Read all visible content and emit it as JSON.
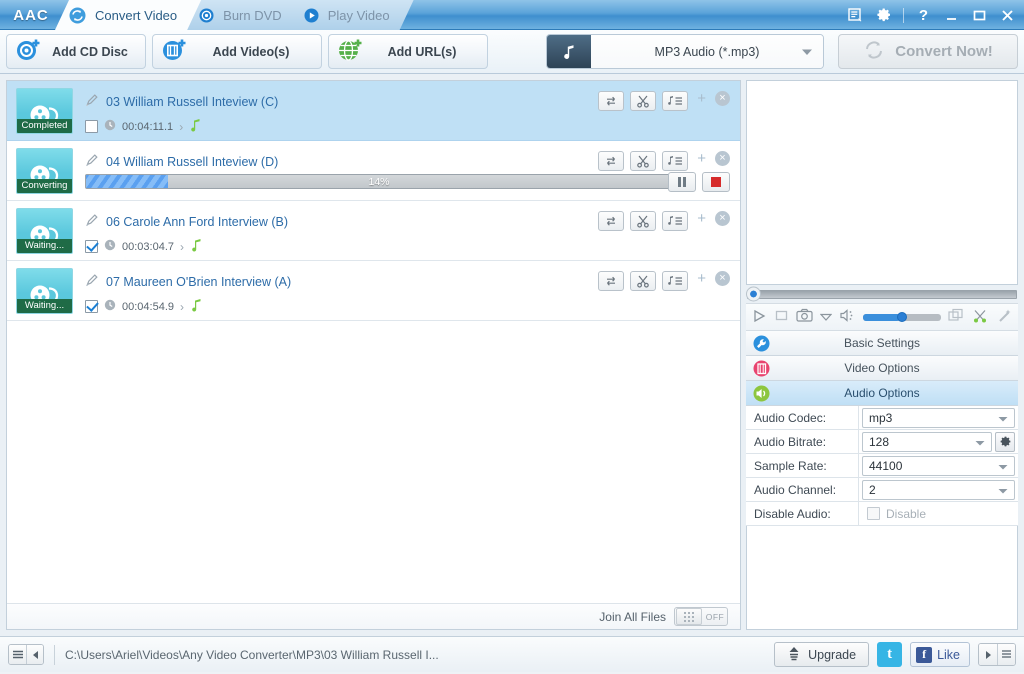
{
  "app": {
    "logo": "AAC"
  },
  "titlebar": {
    "tabs": [
      {
        "label": "Convert Video",
        "icon": "convert-icon",
        "active": true
      },
      {
        "label": "Burn DVD",
        "icon": "disc-icon",
        "active": false
      },
      {
        "label": "Play Video",
        "icon": "play-icon",
        "active": false
      }
    ],
    "window_buttons": [
      {
        "name": "log-icon",
        "glyph": "☰"
      },
      {
        "name": "settings-gear-icon",
        "glyph": "⚙"
      },
      {
        "name": "help-icon",
        "glyph": "?"
      },
      {
        "name": "minimize-icon",
        "glyph": "—"
      },
      {
        "name": "maximize-icon",
        "glyph": "☐"
      },
      {
        "name": "close-icon",
        "glyph": "✕"
      }
    ]
  },
  "toolbar": {
    "add_cd_disc": "Add CD Disc",
    "add_videos": "Add Video(s)",
    "add_urls": "Add URL(s)",
    "format_selected": "MP3 Audio (*.mp3)",
    "convert_now": "Convert Now!"
  },
  "filelist": {
    "rows": [
      {
        "title": "03 William Russell Inteview (C)",
        "status": "Completed",
        "duration": "00:04:11.1",
        "checked": false,
        "selected": true,
        "state": "completed"
      },
      {
        "title": "04 William Russell Inteview (D)",
        "status": "Converting",
        "progress": "14%",
        "progress_value": 14,
        "checked": false,
        "selected": false,
        "state": "converting"
      },
      {
        "title": "06 Carole Ann Ford Interview (B)",
        "status": "Waiting...",
        "duration": "00:03:04.7",
        "checked": true,
        "selected": false,
        "state": "waiting"
      },
      {
        "title": "07 Maureen O'Brien Interview (A)",
        "status": "Waiting...",
        "duration": "00:04:54.9",
        "checked": true,
        "selected": false,
        "state": "waiting"
      }
    ],
    "row_actions": [
      "convert-arrows-icon",
      "scissors-cut-icon",
      "music-list-icon"
    ],
    "join_all_files_label": "Join All Files",
    "join_all_files_state": "OFF"
  },
  "rightpanel": {
    "sections": [
      {
        "label": "Basic Settings",
        "icon": "wrench-icon",
        "active": false
      },
      {
        "label": "Video Options",
        "icon": "film-icon",
        "active": false
      },
      {
        "label": "Audio Options",
        "icon": "speaker-icon",
        "active": true
      }
    ],
    "audio": {
      "codec_label": "Audio Codec:",
      "codec_value": "mp3",
      "bitrate_label": "Audio Bitrate:",
      "bitrate_value": "128",
      "samplerate_label": "Sample Rate:",
      "samplerate_value": "44100",
      "channel_label": "Audio Channel:",
      "channel_value": "2",
      "disable_label": "Disable Audio:",
      "disable_value": "Disable"
    }
  },
  "statusbar": {
    "path": "C:\\Users\\Ariel\\Videos\\Any Video Converter\\MP3\\03 William Russell I...",
    "upgrade": "Upgrade",
    "facebook_like": "Like"
  },
  "colors": {
    "accent": "#2d6ca8",
    "title_gradient_top": "#8fc3e8",
    "badge_green": "#1f6b46",
    "thumb_teal": "#5bc8dd",
    "progress_blue": "#4f97ea",
    "stop_red": "#d62b2b"
  }
}
